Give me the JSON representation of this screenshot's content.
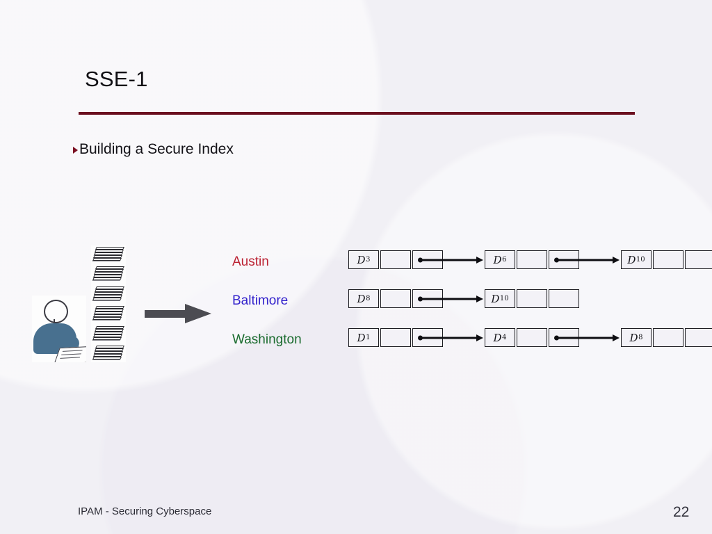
{
  "slide": {
    "title": "SSE-1",
    "bullet": "Building a Secure Index",
    "bullet_marker": "triangle-right",
    "rule_color": "#6b0f1f",
    "background_color": "#f1f0f5"
  },
  "diagram": {
    "person_icon": "person-writing-icon",
    "documents_icon": "document-stacks-icon",
    "process_arrow": "right-block-arrow-icon",
    "document_stack_count": 6,
    "rows": [
      {
        "keyword": "Austin",
        "color": "#bb2233",
        "nodes": [
          {
            "doc": "D",
            "index": "3",
            "has_pointer": true
          },
          {
            "doc": "D",
            "index": "6",
            "has_pointer": true
          },
          {
            "doc": "D",
            "index": "10",
            "has_pointer": false
          }
        ]
      },
      {
        "keyword": "Baltimore",
        "color": "#3322cc",
        "nodes": [
          {
            "doc": "D",
            "index": "8",
            "has_pointer": true
          },
          {
            "doc": "D",
            "index": "10",
            "has_pointer": false
          }
        ]
      },
      {
        "keyword": "Washington",
        "color": "#1a6b2e",
        "nodes": [
          {
            "doc": "D",
            "index": "1",
            "has_pointer": true
          },
          {
            "doc": "D",
            "index": "4",
            "has_pointer": true
          },
          {
            "doc": "D",
            "index": "8",
            "has_pointer": false
          }
        ]
      }
    ]
  },
  "footer": {
    "text": "IPAM - Securing Cyberspace",
    "page_number": "22"
  }
}
